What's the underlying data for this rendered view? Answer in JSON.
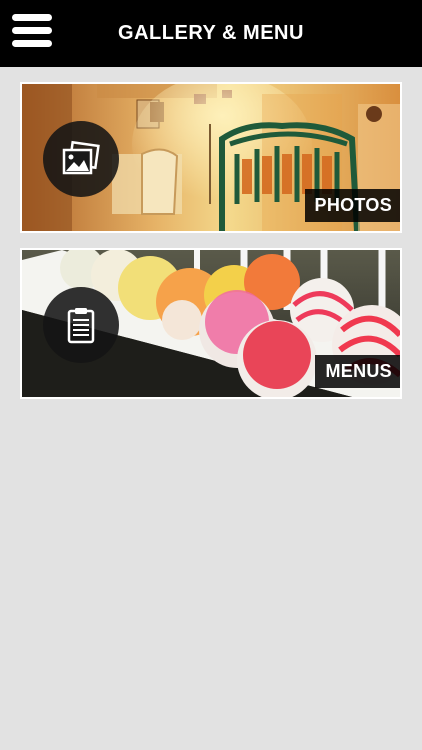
{
  "header": {
    "title": "GALLERY & MENU",
    "menu_icon": "hamburger-menu-icon"
  },
  "cards": [
    {
      "label": "PHOTOS",
      "icon": "photos-icon"
    },
    {
      "label": "MENUS",
      "icon": "clipboard-icon"
    }
  ],
  "colors": {
    "header_bg": "#000000",
    "page_bg": "#e2e2e2",
    "label_bg": "#000000",
    "label_text": "#ffffff"
  }
}
